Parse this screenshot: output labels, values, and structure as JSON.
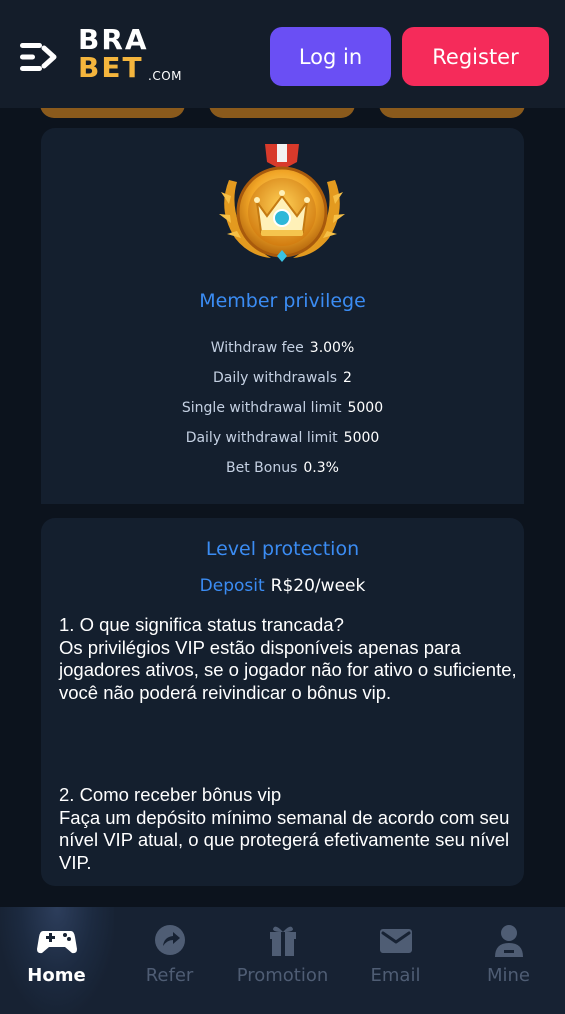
{
  "header": {
    "logo_top": "BRA",
    "logo_bottom": "BET",
    "logo_suffix": ".COM",
    "login_label": "Log in",
    "register_label": "Register"
  },
  "member": {
    "title": "Member privilege",
    "rows": [
      {
        "label": "Withdraw fee",
        "value": "3.00%"
      },
      {
        "label": "Daily withdrawals",
        "value": "2"
      },
      {
        "label": "Single withdrawal limit",
        "value": "5000"
      },
      {
        "label": "Daily withdrawal limit",
        "value": "5000"
      },
      {
        "label": "Bet Bonus",
        "value": "0.3%"
      }
    ]
  },
  "level": {
    "title": "Level protection",
    "deposit_label": "Deposit",
    "deposit_value": "R$20/week",
    "rule1_heading": "1. O que significa status trancada?",
    "rule1_body": "Os privilégios VIP estão disponíveis apenas para jogadores ativos, se o jogador não for ativo o suficiente, você não poderá reivindicar o bônus vip.",
    "rule2_heading": "2. Como receber bônus vip",
    "rule2_body": "Faça um depósito mínimo semanal de acordo com seu nível VIP atual, o que protegerá efetivamente seu nível VIP."
  },
  "nav": {
    "items": [
      {
        "label": "Home",
        "icon": "gamepad-icon",
        "active": true
      },
      {
        "label": "Refer",
        "icon": "share-icon",
        "active": false
      },
      {
        "label": "Promotion",
        "icon": "gift-icon",
        "active": false
      },
      {
        "label": "Email",
        "icon": "mail-icon",
        "active": false
      },
      {
        "label": "Mine",
        "icon": "user-icon",
        "active": false
      }
    ]
  },
  "colors": {
    "background": "#0c131d",
    "header": "#141d2a",
    "card": "#141f2e",
    "accent_blue": "#3b8cf3",
    "login": "#6a4ff4",
    "register": "#f52b5a",
    "logo_gold": "#f4b53d",
    "nav_inactive": "#4f5d74"
  }
}
